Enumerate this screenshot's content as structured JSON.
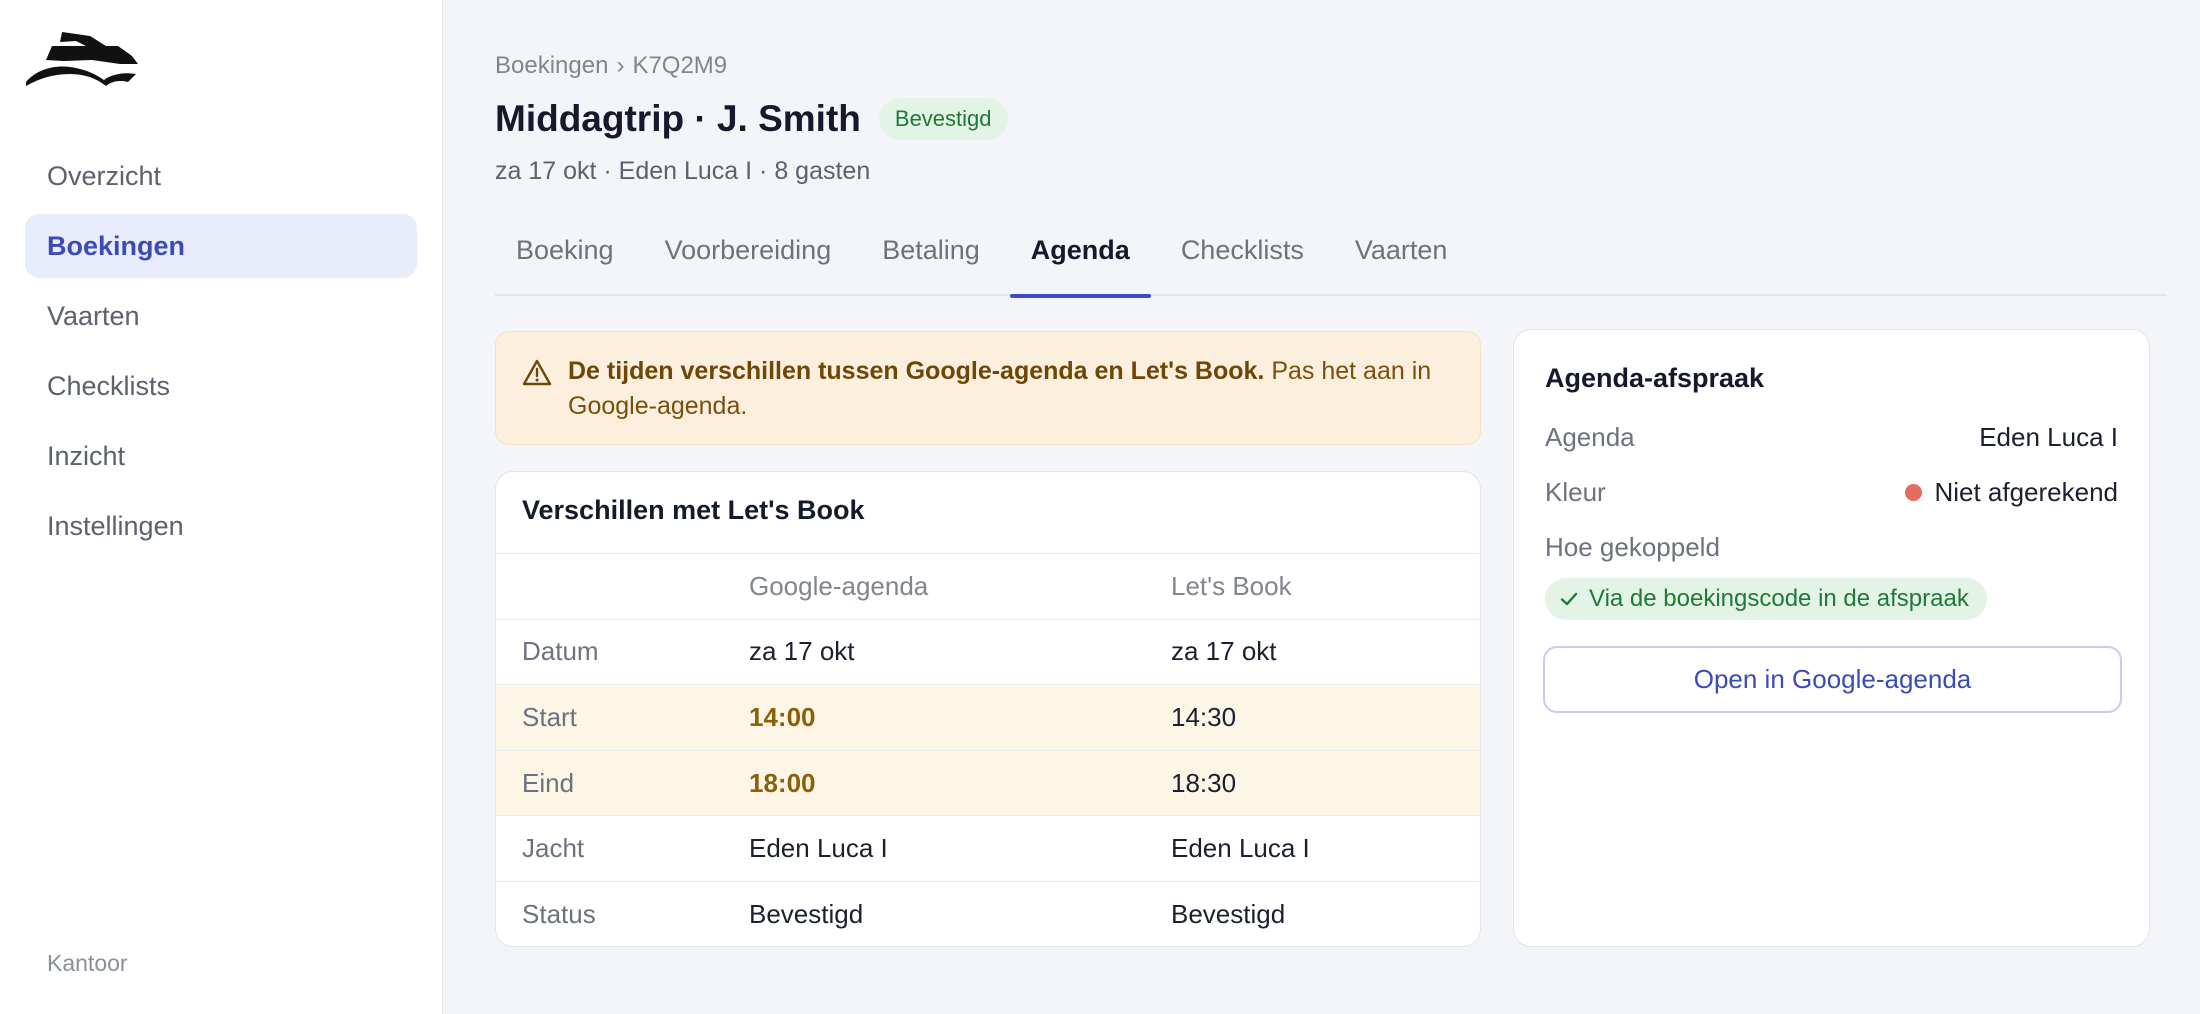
{
  "sidebar": {
    "logo_icon": "yacht-logo-icon",
    "items": [
      {
        "label": "Overzicht",
        "active": false
      },
      {
        "label": "Boekingen",
        "active": true
      },
      {
        "label": "Vaarten",
        "active": false
      },
      {
        "label": "Checklists",
        "active": false
      },
      {
        "label": "Inzicht",
        "active": false
      },
      {
        "label": "Instellingen",
        "active": false
      }
    ],
    "footer": "Kantoor"
  },
  "header": {
    "breadcrumb": {
      "parent": "Boekingen",
      "separator": "›",
      "current": "K7Q2M9"
    },
    "title": "Middagtrip · J. Smith",
    "status": "Bevestigd",
    "subtitle": "za 17 okt · Eden Luca I · 8 gasten"
  },
  "tabs": [
    {
      "label": "Boeking",
      "active": false
    },
    {
      "label": "Voorbereiding",
      "active": false
    },
    {
      "label": "Betaling",
      "active": false
    },
    {
      "label": "Agenda",
      "active": true
    },
    {
      "label": "Checklists",
      "active": false
    },
    {
      "label": "Vaarten",
      "active": false
    }
  ],
  "warning": {
    "icon": "warning-triangle-icon",
    "bold": "De tijden verschillen tussen Google-agenda en Let's Book.",
    "text": "Pas het aan in Google-agenda."
  },
  "diff": {
    "title": "Verschillen met Let's Book",
    "columns": [
      "",
      "Google-agenda",
      "Let's Book"
    ],
    "rows": [
      {
        "label": "Datum",
        "google": "za 17 okt",
        "letsbook": "za 17 okt",
        "differs": false
      },
      {
        "label": "Start",
        "google": "14:00",
        "letsbook": "14:30",
        "differs": true
      },
      {
        "label": "Eind",
        "google": "18:00",
        "letsbook": "18:30",
        "differs": true
      },
      {
        "label": "Jacht",
        "google": "Eden Luca I",
        "letsbook": "Eden Luca I",
        "differs": false
      },
      {
        "label": "Status",
        "google": "Bevestigd",
        "letsbook": "Bevestigd",
        "differs": false
      }
    ]
  },
  "appointment": {
    "title": "Agenda-afspraak",
    "agenda_label": "Agenda",
    "agenda_value": "Eden Luca I",
    "color_label": "Kleur",
    "color_value": "Niet afgerekend",
    "color_hex": "#e36c5f",
    "linked_label": "Hoe gekoppeld",
    "linked_value": "Via de boekingscode in de afspraak",
    "linked_icon": "check-icon",
    "open_button": "Open in Google-agenda"
  },
  "colors": {
    "accent": "#3b4bcc",
    "active_nav_bg": "#e9ecfb",
    "warning_bg": "#fcefde",
    "success_bg": "#e3f3e5",
    "success_text": "#1f7a36"
  }
}
